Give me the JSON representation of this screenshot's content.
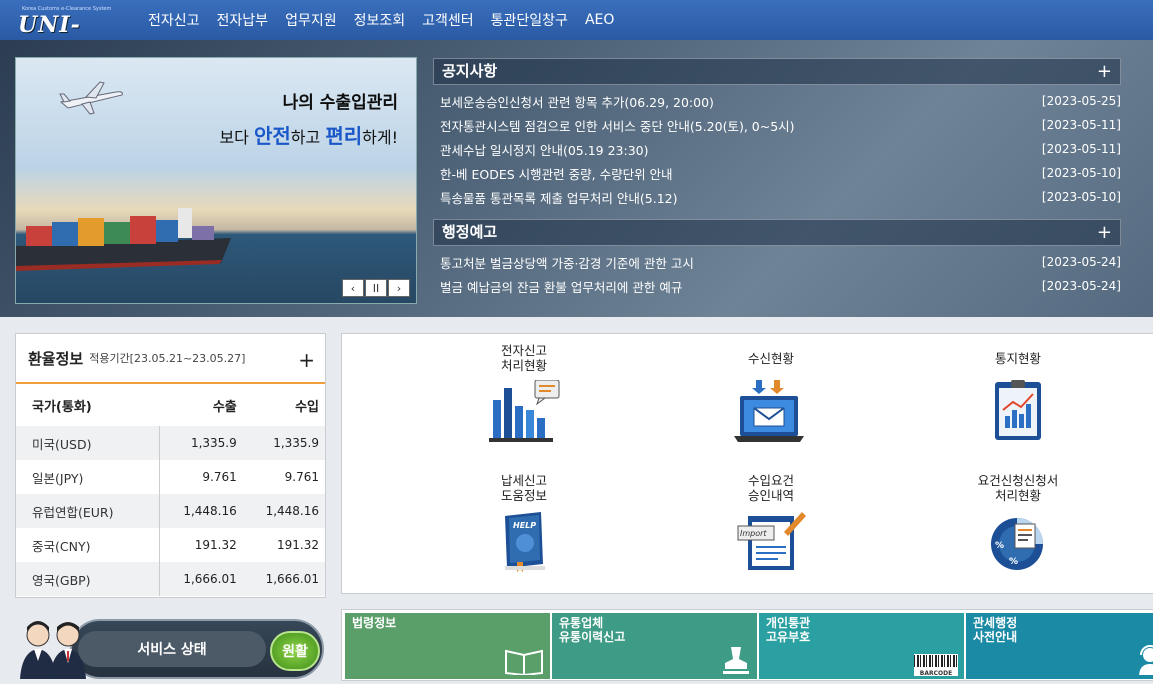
{
  "logo": {
    "subtitle": "Korea Customs e-Clearance System",
    "name": "UNI-PASS"
  },
  "menu": [
    "전자신고",
    "전자납부",
    "업무지원",
    "정보조회",
    "고객센터",
    "통관단일창구",
    "AEO"
  ],
  "banner": {
    "line1": "나의 수출입관리",
    "line2_pre": "보다 ",
    "line2_em1": "안전",
    "line2_mid": "하고 ",
    "line2_em2": "편리",
    "line2_post": "하게!",
    "controls": [
      "‹",
      "II",
      "›"
    ]
  },
  "notices": {
    "title": "공지사항",
    "plus": "+",
    "items": [
      {
        "text": "보세운송승인신청서 관련 항목 추가(06.29, 20:00)",
        "date": "[2023-05-25]"
      },
      {
        "text": "전자통관시스템 점검으로 인한 서비스 중단 안내(5.20(토), 0~5시)",
        "date": "[2023-05-11]"
      },
      {
        "text": "관세수납 일시정지 안내(05.19 23:30)",
        "date": "[2023-05-11]"
      },
      {
        "text": "한-베 EODES 시행관련 중량, 수량단위 안내",
        "date": "[2023-05-10]"
      },
      {
        "text": "특송물품 통관목록 제출 업무처리 안내(5.12)",
        "date": "[2023-05-10]"
      }
    ]
  },
  "admin": {
    "title": "행정예고",
    "plus": "+",
    "items": [
      {
        "text": "통고처분 벌금상당액 가중·감경 기준에 관한 고시",
        "date": "[2023-05-24]"
      },
      {
        "text": "벌금 예납금의 잔금 환불 업무처리에 관한 예규",
        "date": "[2023-05-24]"
      }
    ]
  },
  "rates": {
    "title": "환율정보",
    "period": "적용기간[23.05.21~23.05.27]",
    "plus": "+",
    "headers": [
      "국가(통화)",
      "수출",
      "수입"
    ],
    "rows": [
      [
        "미국(USD)",
        "1,335.9",
        "1,335.9"
      ],
      [
        "일본(JPY)",
        "9.761",
        "9.761"
      ],
      [
        "유럽연합(EUR)",
        "1,448.16",
        "1,448.16"
      ],
      [
        "중국(CNY)",
        "191.32",
        "191.32"
      ],
      [
        "영국(GBP)",
        "1,666.01",
        "1,666.01"
      ]
    ]
  },
  "status": {
    "label": "서비스 상태",
    "value": "원활"
  },
  "services": [
    {
      "l1": "전자신고",
      "l2": "처리현황",
      "icon": "bar-chart-icon"
    },
    {
      "l1": "수신현황",
      "l2": "",
      "icon": "mail-monitor-icon"
    },
    {
      "l1": "통지현황",
      "l2": "",
      "icon": "clipboard-chart-icon"
    },
    {
      "l1": "납세신고",
      "l2": "도움정보",
      "icon": "help-book-icon"
    },
    {
      "l1": "수입요건",
      "l2": "승인내역",
      "icon": "import-document-icon"
    },
    {
      "l1": "요건신청신청서",
      "l2": "처리현황",
      "icon": "percent-pie-icon"
    }
  ],
  "tiles": [
    {
      "l1": "법령정보",
      "l2": "",
      "color": "#5a9e6a"
    },
    {
      "l1": "유통업체",
      "l2": "유통이력신고",
      "color": "#3e9b85"
    },
    {
      "l1": "개인통관",
      "l2": "고유부호",
      "color": "#2aa0a2",
      "badge": "BARCODE"
    },
    {
      "l1": "관세행정",
      "l2": "사전안내",
      "color": "#1b8aa4"
    }
  ]
}
